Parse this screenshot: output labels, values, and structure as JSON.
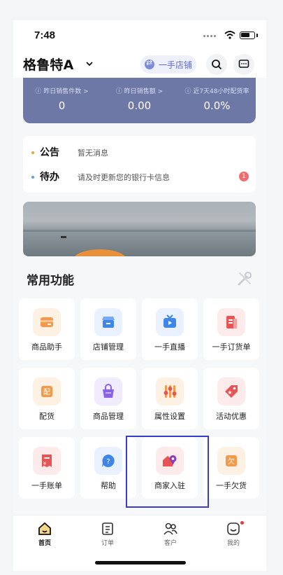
{
  "status_bar": {
    "time": "7:48"
  },
  "header": {
    "store_name": "格鲁特A",
    "switch_label": "一手店铺"
  },
  "stats": [
    {
      "label": "ⓘ 昨日销售件数 >",
      "value": "0"
    },
    {
      "label": "ⓘ 昨日销售额 >",
      "value": "0.00"
    },
    {
      "label": "ⓘ 近7天48小时配货率",
      "value": "0.0%"
    }
  ],
  "notices": [
    {
      "title": "公告",
      "text": "暂无消息",
      "dot_color": "#f0a23a"
    },
    {
      "title": "待办",
      "text": "请及时更新您的银行卡信息",
      "dot_color": "#5aa0e8",
      "badge": "1"
    }
  ],
  "section": {
    "title": "常用功能"
  },
  "features": [
    {
      "label": "商品助手",
      "icon": "product-assistant-icon",
      "bg": "#fdf1e4"
    },
    {
      "label": "店铺管理",
      "icon": "store-management-icon",
      "bg": "#e8f1fd"
    },
    {
      "label": "一手直播",
      "icon": "live-stream-icon",
      "bg": "#e8f1fd"
    },
    {
      "label": "一手订货单",
      "icon": "order-form-icon",
      "bg": "#fdeaea"
    },
    {
      "label": "配货",
      "icon": "distribution-icon",
      "bg": "#fdf1e4"
    },
    {
      "label": "商品管理",
      "icon": "product-management-icon",
      "bg": "#f1ecfd"
    },
    {
      "label": "属性设置",
      "icon": "attribute-settings-icon",
      "bg": "#fdf1e4"
    },
    {
      "label": "活动优惠",
      "icon": "promotion-icon",
      "bg": "#fdeaea"
    },
    {
      "label": "一手账单",
      "icon": "bill-icon",
      "bg": "#fdeaea"
    },
    {
      "label": "帮助",
      "icon": "help-icon",
      "bg": "#e8f1fd"
    },
    {
      "label": "商家入驻",
      "icon": "merchant-join-icon",
      "bg": "#fdeaea"
    },
    {
      "label": "一手欠货",
      "icon": "backorder-icon",
      "bg": "#fdf1e4"
    }
  ],
  "tabs": [
    {
      "label": "首页",
      "icon": "home-icon",
      "active": true
    },
    {
      "label": "订单",
      "icon": "order-icon"
    },
    {
      "label": "客户",
      "icon": "customers-icon"
    },
    {
      "label": "我的",
      "icon": "profile-icon",
      "badge_dot": true
    }
  ]
}
